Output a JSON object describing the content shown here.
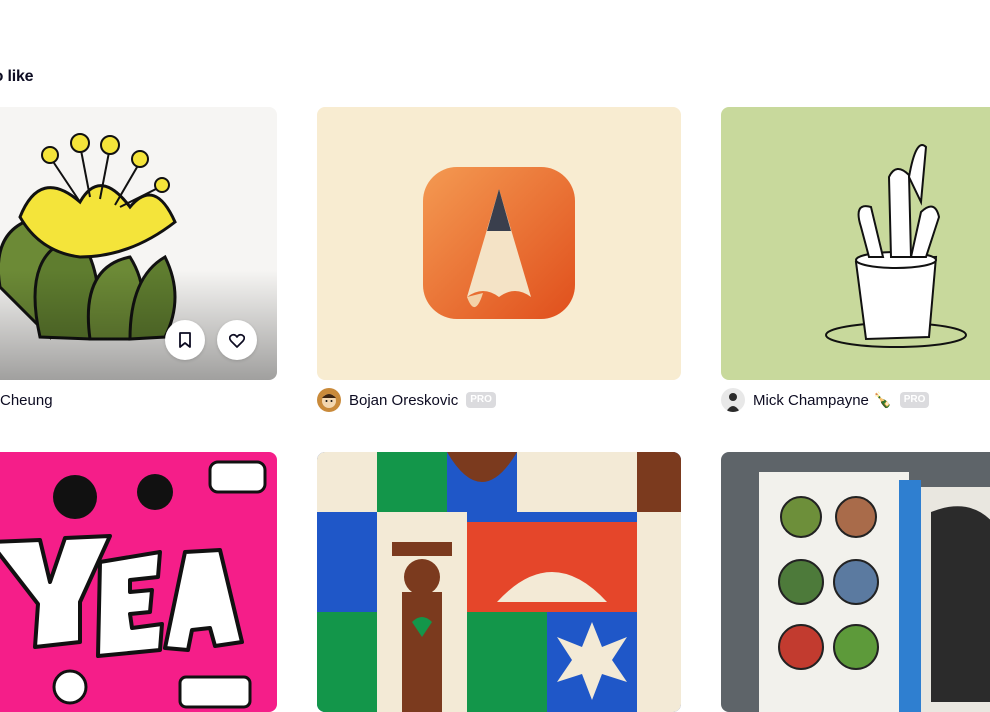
{
  "section": {
    "title": "also like"
  },
  "cards": [
    {
      "author": "Cheung",
      "pro_badge": ""
    },
    {
      "author": "Bojan Oreskovic",
      "pro_badge": "PRO"
    },
    {
      "author": "Mick Champayne 🍾",
      "pro_badge": "PRO"
    },
    {
      "author": "",
      "pro_badge": ""
    },
    {
      "author": "",
      "pro_badge": ""
    },
    {
      "author": "",
      "pro_badge": ""
    }
  ],
  "actions": {
    "bookmark_icon": "bookmark-icon",
    "like_icon": "heart-icon"
  },
  "colors": {
    "pink": "#f51e89",
    "cream": "#f7ebcd",
    "sage": "#c6d89a",
    "orange": "#ea6a2c",
    "blue": "#1f57c8",
    "green": "#13964a",
    "red": "#e5462a"
  }
}
